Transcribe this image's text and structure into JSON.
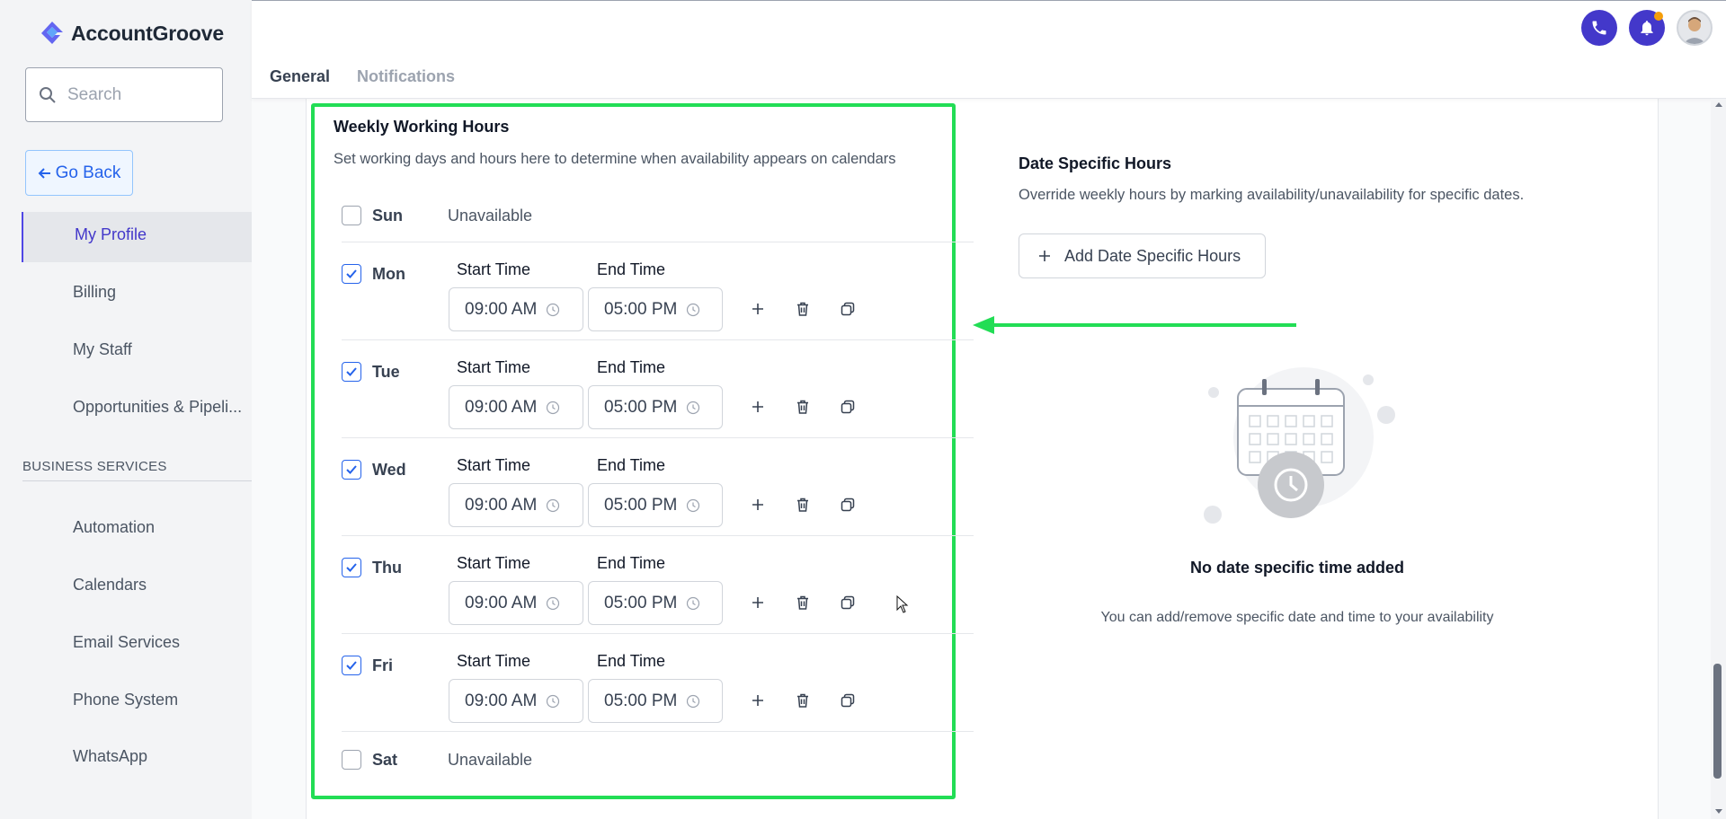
{
  "brand": {
    "name": "AccountGroove",
    "accent": "#4338ca",
    "logo_icon": "account-groove-logo"
  },
  "sidebar": {
    "search": {
      "placeholder": "Search"
    },
    "go_back": {
      "label": "Go Back"
    },
    "items": [
      {
        "label": "My Profile",
        "active": true
      },
      {
        "label": "Billing"
      },
      {
        "label": "My Staff"
      },
      {
        "label": "Opportunities & Pipeli..."
      }
    ],
    "section_label": "BUSINESS SERVICES",
    "business_items": [
      {
        "label": "Automation"
      },
      {
        "label": "Calendars"
      },
      {
        "label": "Email Services"
      },
      {
        "label": "Phone System"
      },
      {
        "label": "WhatsApp"
      }
    ]
  },
  "header": {
    "tabs": [
      {
        "label": "General",
        "active": true
      },
      {
        "label": "Notifications"
      }
    ],
    "icons": [
      "phone-icon",
      "bell-icon",
      "avatar"
    ]
  },
  "weekly": {
    "title": "Weekly Working Hours",
    "description": "Set working days and hours here to determine when availability appears on calendars",
    "start_label": "Start Time",
    "end_label": "End Time",
    "unavailable_label": "Unavailable",
    "days": [
      {
        "day": "Sun",
        "checked": false
      },
      {
        "day": "Mon",
        "checked": true,
        "start": "09:00 AM",
        "end": "05:00 PM"
      },
      {
        "day": "Tue",
        "checked": true,
        "start": "09:00 AM",
        "end": "05:00 PM"
      },
      {
        "day": "Wed",
        "checked": true,
        "start": "09:00 AM",
        "end": "05:00 PM"
      },
      {
        "day": "Thu",
        "checked": true,
        "start": "09:00 AM",
        "end": "05:00 PM"
      },
      {
        "day": "Fri",
        "checked": true,
        "start": "09:00 AM",
        "end": "05:00 PM"
      },
      {
        "day": "Sat",
        "checked": false
      }
    ]
  },
  "date_specific": {
    "title": "Date Specific Hours",
    "description": "Override weekly hours by marking availability/unavailability for specific dates.",
    "add_button": "Add Date Specific Hours",
    "empty_title": "No date specific time added",
    "empty_description": "You can add/remove specific date and time to your availability"
  },
  "annotation": {
    "highlight_color": "#22dd55"
  }
}
